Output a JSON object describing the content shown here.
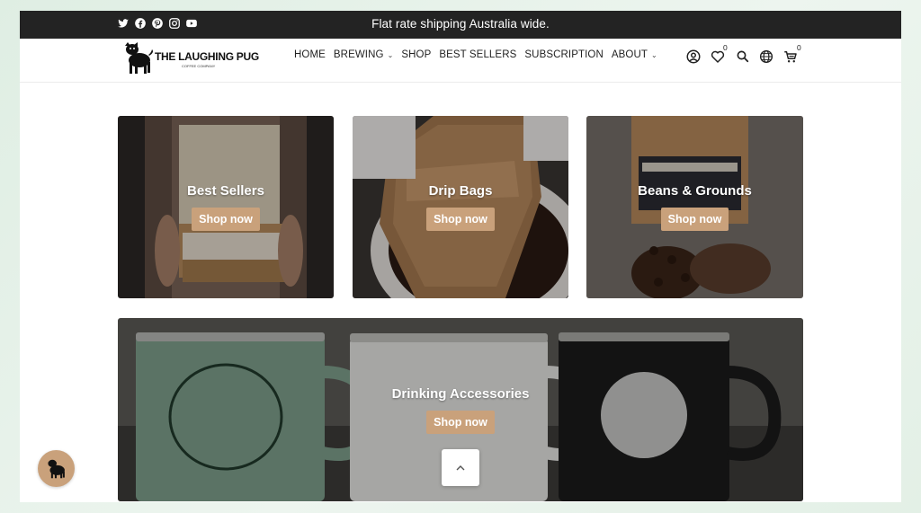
{
  "announcement": {
    "text": "Flat rate shipping Australia wide.",
    "socials": [
      "twitter-icon",
      "facebook-icon",
      "pinterest-icon",
      "instagram-icon",
      "youtube-icon"
    ]
  },
  "header": {
    "logo_text": "THE LAUGHING PUG",
    "logo_sub": "COFFEE COMPANY",
    "nav": [
      {
        "label": "HOME",
        "dropdown": false
      },
      {
        "label": "BREWING",
        "dropdown": true
      },
      {
        "label": "SHOP",
        "dropdown": false
      },
      {
        "label": "BEST SELLERS",
        "dropdown": false
      },
      {
        "label": "SUBSCRIPTION",
        "dropdown": false
      },
      {
        "label": "ABOUT",
        "dropdown": true
      }
    ],
    "wishlist_count": "0",
    "cart_count": "0"
  },
  "collections": [
    {
      "title": "Best Sellers",
      "button": "Shop now"
    },
    {
      "title": "Drip Bags",
      "button": "Shop now"
    },
    {
      "title": "Beans & Grounds",
      "button": "Shop now"
    },
    {
      "title": "Drinking Accessories",
      "button": "Shop now"
    }
  ],
  "colors": {
    "accent": "#c9a17b",
    "announcement_bg": "#232323"
  }
}
